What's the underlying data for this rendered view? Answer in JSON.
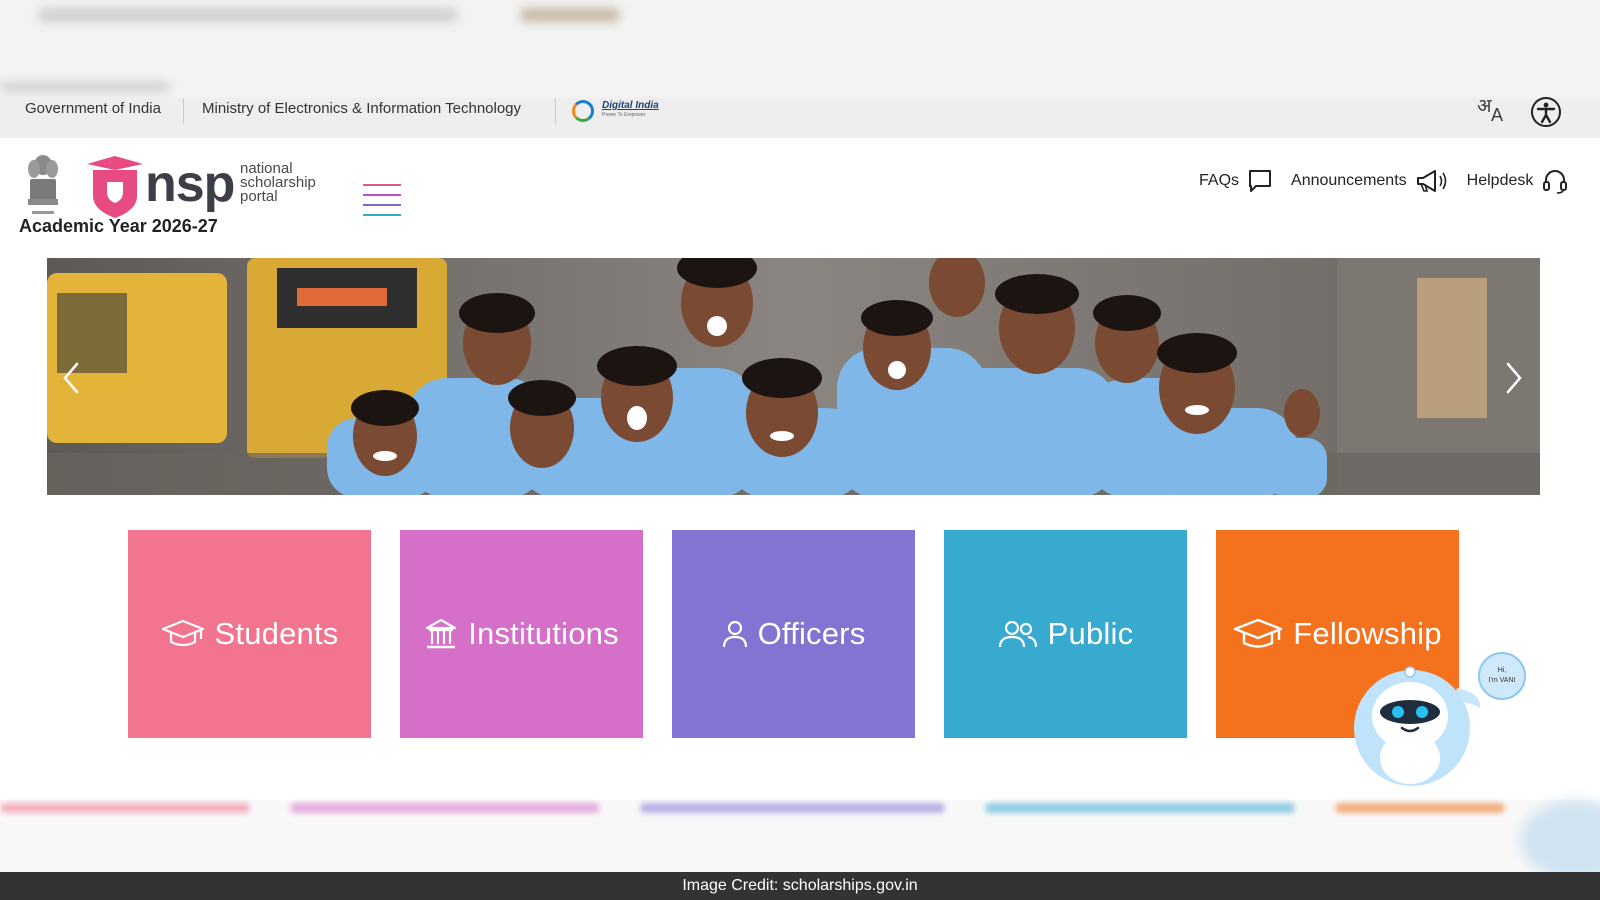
{
  "gov_strip": {
    "government": "Government of India",
    "ministry": "Ministry of Electronics & Information Technology",
    "digital_india": "Digital India",
    "digital_india_tagline": "Power To Empower",
    "language_icon": "language-toggle-icon",
    "accessibility_icon": "accessibility-icon"
  },
  "header": {
    "logo_word": "nsp",
    "logo_tagline": [
      "national",
      "scholarship",
      "portal"
    ],
    "academic_year": "Academic Year 2026-27",
    "links": [
      {
        "label": "FAQs",
        "icon": "chat-icon"
      },
      {
        "label": "Announcements",
        "icon": "megaphone-icon"
      },
      {
        "label": "Helpdesk",
        "icon": "headset-icon"
      }
    ]
  },
  "carousel": {
    "prev_icon": "chevron-left-icon",
    "next_icon": "chevron-right-icon"
  },
  "tiles": [
    {
      "label": "Students",
      "icon": "graduation-cap-icon",
      "color": "#f2748f"
    },
    {
      "label": "Institutions",
      "icon": "institution-icon",
      "color": "#d56fc8"
    },
    {
      "label": "Officers",
      "icon": "user-icon",
      "color": "#8274d3"
    },
    {
      "label": "Public",
      "icon": "users-icon",
      "color": "#38a9cf"
    },
    {
      "label": "Fellowship",
      "icon": "graduation-cap-icon",
      "color": "#f4711e"
    }
  ],
  "chatbot": {
    "greeting_line1": "Hi,",
    "greeting_line2": "I'm VANI"
  },
  "credit": "Image Credit: scholarships.gov.in"
}
